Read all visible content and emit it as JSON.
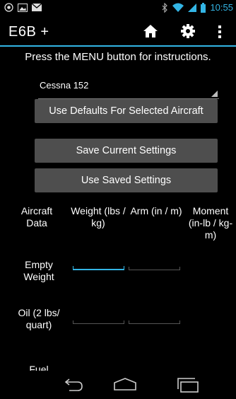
{
  "status_bar": {
    "time": "10:55",
    "icons": [
      "location-icon",
      "gallery-icon",
      "mail-icon",
      "bluetooth-icon",
      "wifi-icon",
      "cell-signal-icon",
      "battery-icon"
    ],
    "accent_color": "#33b5e5"
  },
  "action_bar": {
    "title": "E6B +",
    "icons": [
      "home-icon",
      "gear-icon",
      "overflow-menu-icon"
    ]
  },
  "main": {
    "instructions": "Press the MENU button for instructions.",
    "aircraft_spinner": {
      "selected": "Cessna 152"
    },
    "buttons": {
      "use_defaults": "Use Defaults For Selected Aircraft",
      "save_current": "Save Current Settings",
      "use_saved": "Use Saved Settings"
    },
    "table": {
      "headers": {
        "aircraft_data": "Aircraft Data",
        "weight": "Weight (lbs / kg)",
        "arm": "Arm (in / m)",
        "moment": "Moment (in-lb / kg-m)"
      },
      "rows": [
        {
          "label": "Empty Weight",
          "weight": "",
          "arm": ""
        },
        {
          "label": "Oil (2 lbs/ quart)",
          "weight": "",
          "arm": ""
        },
        {
          "label": "Fuel"
        }
      ]
    }
  },
  "nav_bar": {
    "icons": [
      "back-icon",
      "home-nav-icon",
      "recent-apps-icon"
    ]
  }
}
